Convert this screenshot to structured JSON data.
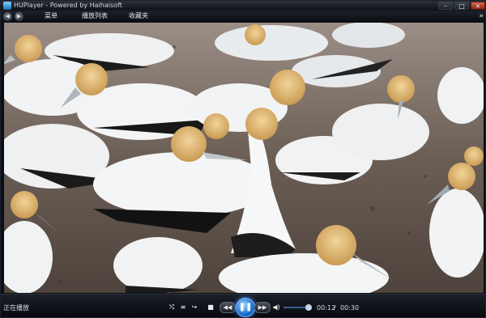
{
  "window": {
    "title": "HUPlayer - Powered by Haihaisoft"
  },
  "menu": {
    "items": [
      "菜单",
      "播放列表",
      "收藏夹"
    ]
  },
  "status": {
    "text": "正在播放"
  },
  "time": {
    "current": "00:12",
    "separator": "/",
    "total": "00:30"
  },
  "volume": {
    "level": 0.85
  },
  "colors": {
    "accent": "#2a7fdc",
    "chrome": "#0b0e14"
  }
}
